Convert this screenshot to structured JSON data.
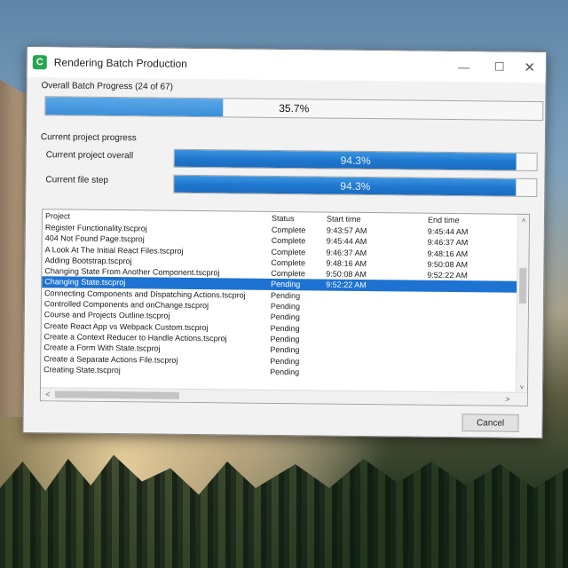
{
  "window": {
    "title": "Rendering Batch Production",
    "app_icon_letter": "C",
    "controls": {
      "minimize": "—",
      "maximize": "☐",
      "close": "✕"
    }
  },
  "overall": {
    "label": "Overall Batch Progress (24 of 67)",
    "percent_text": "35.7%",
    "fraction": 0.357
  },
  "current": {
    "section_label": "Current project progress",
    "project_label": "Current project overall",
    "project_percent_text": "94.3%",
    "project_fraction": 0.943,
    "file_label": "Current file step",
    "file_percent_text": "94.3%",
    "file_fraction": 0.943
  },
  "table": {
    "headers": {
      "project": "Project",
      "status": "Status",
      "start": "Start time",
      "end": "End time"
    },
    "rows": [
      {
        "project": "Register Functionality.tscproj",
        "status": "Complete",
        "start": "9:43:57 AM",
        "end": "9:45:44 AM"
      },
      {
        "project": "404 Not Found Page.tscproj",
        "status": "Complete",
        "start": "9:45:44 AM",
        "end": "9:46:37 AM"
      },
      {
        "project": "A Look At The Initial React Files.tscproj",
        "status": "Complete",
        "start": "9:46:37 AM",
        "end": "9:48:16 AM"
      },
      {
        "project": "Adding Bootstrap.tscproj",
        "status": "Complete",
        "start": "9:48:16 AM",
        "end": "9:50:08 AM"
      },
      {
        "project": "Changing State From Another Component.tscproj",
        "status": "Complete",
        "start": "9:50:08 AM",
        "end": "9:52:22 AM"
      },
      {
        "project": "Changing State.tscproj",
        "status": "Pending",
        "start": "9:52:22 AM",
        "end": ""
      },
      {
        "project": "Connecting Components and Dispatching Actions.tscproj",
        "status": "Pending",
        "start": "",
        "end": ""
      },
      {
        "project": "Controlled Components and onChange.tscproj",
        "status": "Pending",
        "start": "",
        "end": ""
      },
      {
        "project": "Course and Projects Outline.tscproj",
        "status": "Pending",
        "start": "",
        "end": ""
      },
      {
        "project": "Create React App vs Webpack Custom.tscproj",
        "status": "Pending",
        "start": "",
        "end": ""
      },
      {
        "project": "Create a Context Reducer to Handle Actions.tscproj",
        "status": "Pending",
        "start": "",
        "end": ""
      },
      {
        "project": "Create a Form With State.tscproj",
        "status": "Pending",
        "start": "",
        "end": ""
      },
      {
        "project": "Create a Separate Actions File.tscproj",
        "status": "Pending",
        "start": "",
        "end": ""
      },
      {
        "project": "Creating State.tscproj",
        "status": "Pending",
        "start": "",
        "end": ""
      }
    ],
    "selected_index": 5
  },
  "scroll": {
    "up": "˄",
    "down": "˅",
    "left": "<",
    "right": ">"
  },
  "cancel_label": "Cancel"
}
